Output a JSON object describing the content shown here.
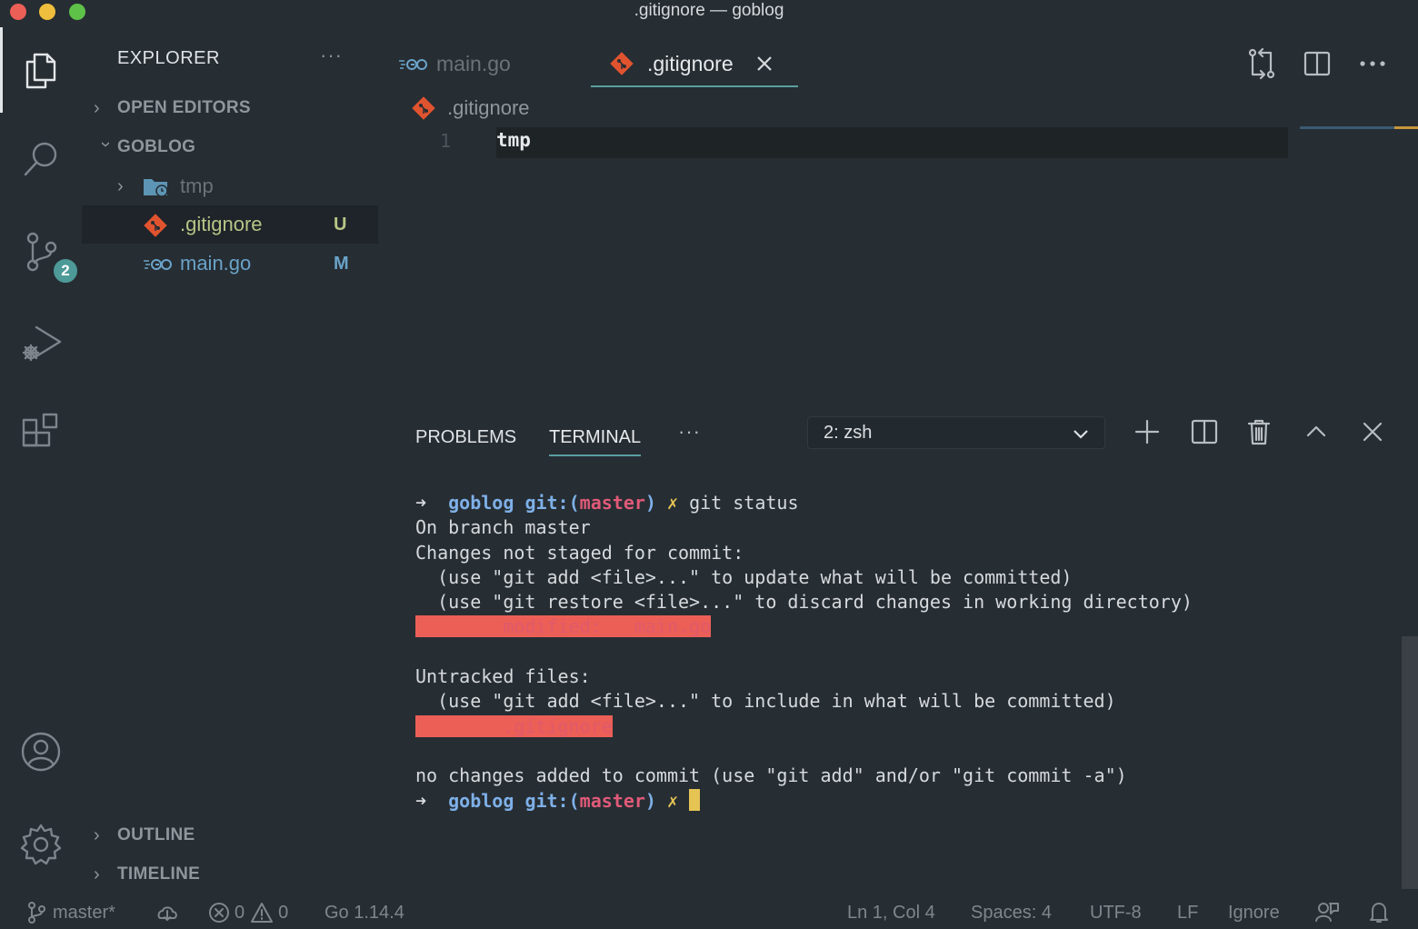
{
  "window": {
    "title": ".gitignore — goblog"
  },
  "activity_bar": {
    "scm_badge": "2"
  },
  "sidebar": {
    "title": "EXPLORER",
    "more": "···",
    "sections": {
      "open_editors": "OPEN EDITORS",
      "project": "GOBLOG",
      "outline": "OUTLINE",
      "timeline": "TIMELINE"
    },
    "files": [
      {
        "name": "tmp",
        "status": ""
      },
      {
        "name": ".gitignore",
        "status": "U"
      },
      {
        "name": "main.go",
        "status": "M"
      }
    ]
  },
  "tabs": [
    {
      "label": "main.go"
    },
    {
      "label": ".gitignore"
    }
  ],
  "editor": {
    "breadcrumb": ".gitignore",
    "line_number": "1",
    "line_text": "tmp"
  },
  "panel": {
    "tabs": {
      "problems": "PROBLEMS",
      "terminal": "TERMINAL"
    },
    "more": "···",
    "terminal_select": "2: zsh"
  },
  "terminal": {
    "prompt_arrow": "➜",
    "dir": "goblog",
    "git_prefix": "git:(",
    "branch": "master",
    "git_suffix": ")",
    "dirty": "✗",
    "command": "git status",
    "lines": {
      "l1": "On branch master",
      "l2": "Changes not staged for commit:",
      "l3": "  (use \"git add <file>...\" to update what will be committed)",
      "l4": "  (use \"git restore <file>...\" to discard changes in working directory)",
      "l5_label": "        modified:   ",
      "l5_file": "main.go",
      "l6": "Untracked files:",
      "l7": "  (use \"git add <file>...\" to include in what will be committed)",
      "l8_file": "        .gitignore",
      "l9": "no changes added to commit (use \"git add\" and/or \"git commit -a\")"
    }
  },
  "status_bar": {
    "branch": "master*",
    "errors": "0",
    "warnings": "0",
    "go_version": "Go 1.14.4",
    "position": "Ln 1, Col 4",
    "spaces": "Spaces: 4",
    "encoding": "UTF-8",
    "eol": "LF",
    "language": "Ignore"
  },
  "colors": {
    "accent": "#5c9ea0",
    "git_icon": "#e0532f",
    "go_icon": "#6aa3c8"
  }
}
